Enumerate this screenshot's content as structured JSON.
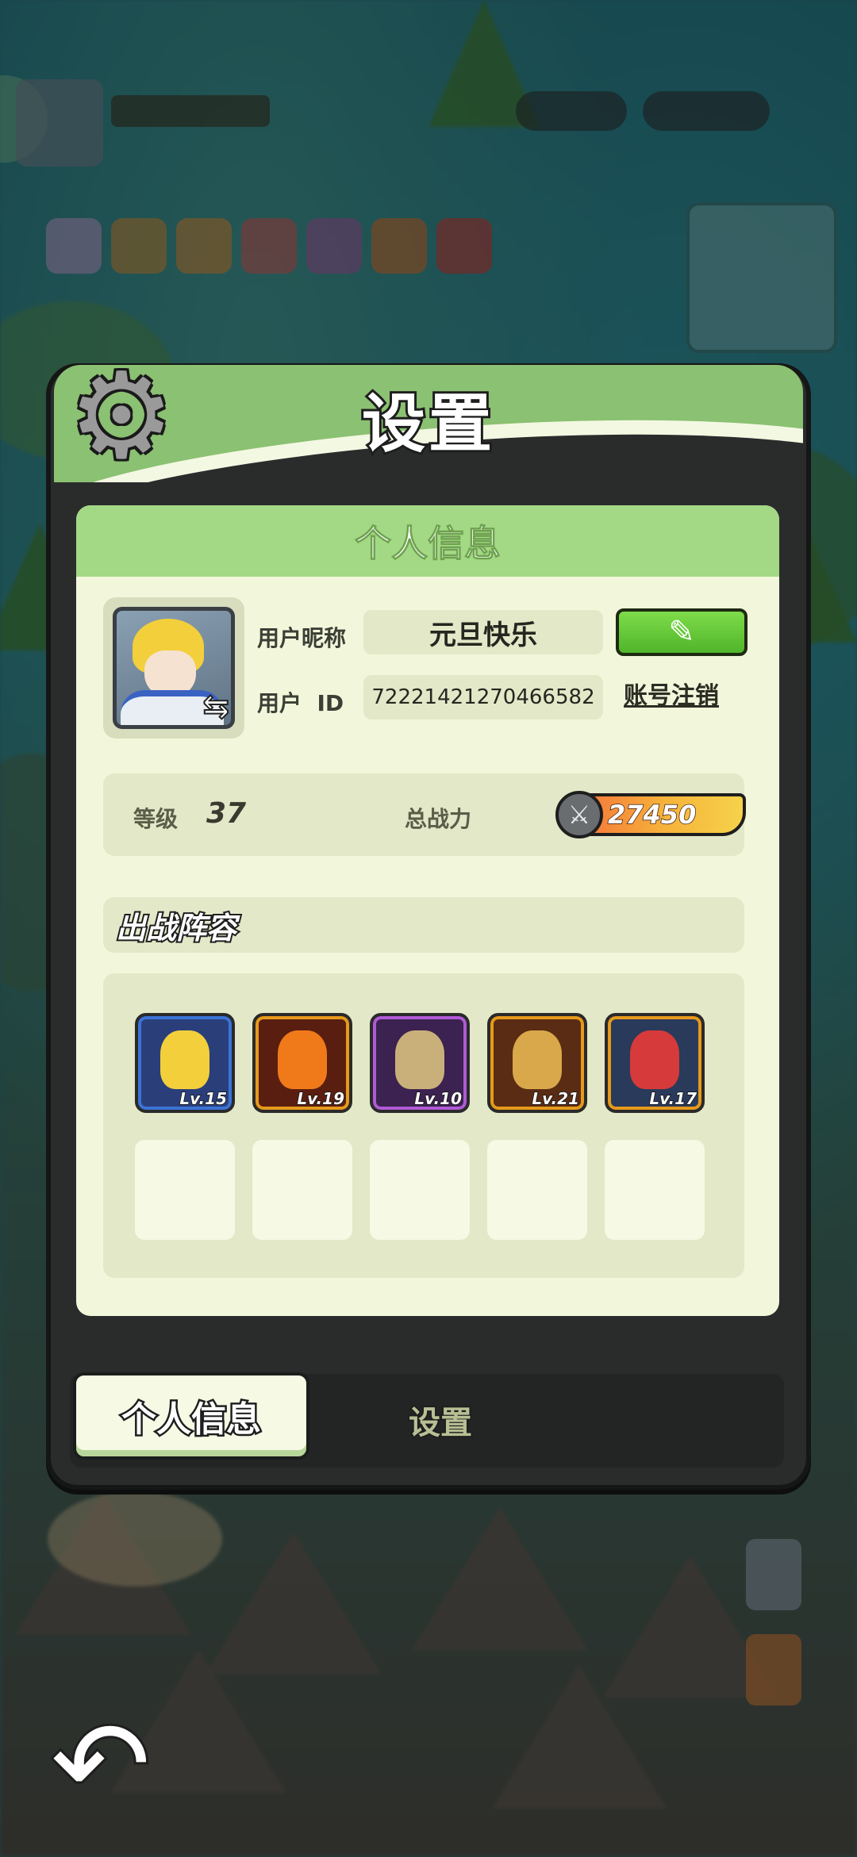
{
  "panel": {
    "title": "设置",
    "card_title": "个人信息"
  },
  "profile": {
    "nickname_label": "用户昵称",
    "nickname": "元旦快乐",
    "id_label": "用户  ID",
    "user_id": "72221421270466582",
    "logout_label": "账号注销",
    "level_label": "等级",
    "level": "37",
    "power_label": "总战力",
    "power": "27450"
  },
  "lineup": {
    "title": "出战阵容",
    "heroes": [
      {
        "level": "Lv.15",
        "border": "#3a73d6",
        "bg": "#2a3f7a"
      },
      {
        "level": "Lv.19",
        "border": "#e69a1a",
        "bg": "#5a1e10"
      },
      {
        "level": "Lv.10",
        "border": "#b05ad6",
        "bg": "#3b2250"
      },
      {
        "level": "Lv.21",
        "border": "#e69a1a",
        "bg": "#5a2c14"
      },
      {
        "level": "Lv.17",
        "border": "#e69a1a",
        "bg": "#2a3a5a"
      }
    ]
  },
  "tabs": {
    "active": "个人信息",
    "inactive": "设置"
  },
  "icons": {
    "gear": "gear-icon",
    "edit": "pencil-icon",
    "swap": "swap-icon",
    "power": "crossed-swords-icon",
    "back": "back-arrow-icon"
  },
  "colors": {
    "accent_green": "#8bc172",
    "card_bg": "#f2f7dc",
    "edit_button": "#5cc232"
  }
}
